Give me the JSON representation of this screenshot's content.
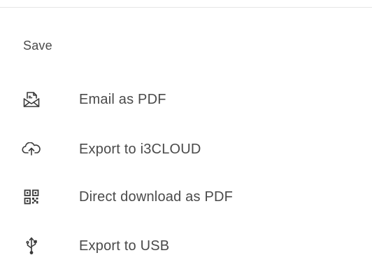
{
  "menu": {
    "section_title": "Save",
    "items": [
      {
        "label": "Email as PDF",
        "icon": "email-pdf-icon"
      },
      {
        "label": "Export to i3CLOUD",
        "icon": "cloud-upload-icon"
      },
      {
        "label": "Direct download as PDF",
        "icon": "qr-code-icon"
      },
      {
        "label": "Export to USB",
        "icon": "usb-icon"
      }
    ]
  },
  "colors": {
    "text": "#4a4a4a",
    "icon": "#3a3a3a",
    "divider": "#e6e6e6",
    "background": "#ffffff"
  }
}
